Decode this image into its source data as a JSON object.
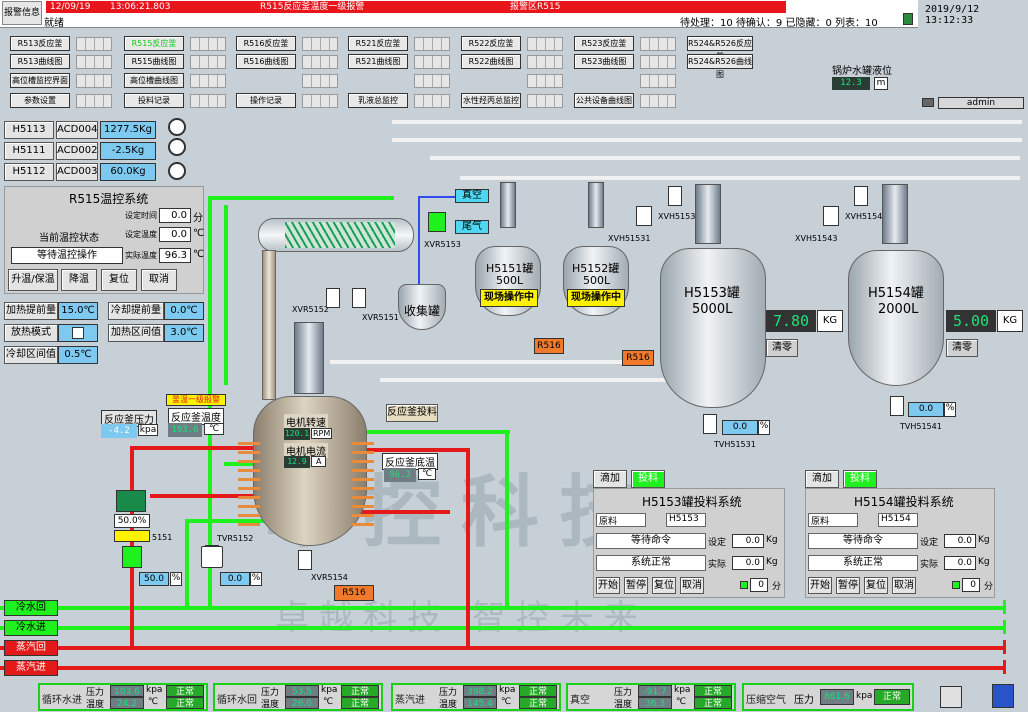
{
  "alarm": {
    "button": "报警信息",
    "date": "12/09/19",
    "time": "13:06:21.803",
    "message": "R515反应釜温度一级报警",
    "area": "报警区R515",
    "status": "就绪",
    "counts": "待处理：10  待确认：9  已隐藏：0  列表：10"
  },
  "datetime": "2019/9/12  13:12:33",
  "nav": {
    "row1": [
      "R513反应釜",
      "R515反应釜",
      "R516反应釜",
      "R521反应釜",
      "R522反应釜",
      "R523反应釜",
      "R524&R526反应釜"
    ],
    "row2": [
      "R513曲线图",
      "R515曲线图",
      "R516曲线图",
      "R521曲线图",
      "R522曲线图",
      "R523曲线图",
      "R524&R526曲线图"
    ],
    "row3": [
      "高位槽监控界面",
      "高位槽曲线图"
    ],
    "row4": [
      "参数设置",
      "投料记录",
      "操作记录",
      "乳液总监控",
      "水性羟丙总监控",
      "公共设备曲线图"
    ]
  },
  "boiler": {
    "title": "锅炉水罐液位",
    "value": "12.3",
    "unit": "m"
  },
  "user": "admin",
  "weights": [
    {
      "tank": "H5113",
      "acd": "ACD004",
      "value": "1277.5Kg"
    },
    {
      "tank": "H5111",
      "acd": "ACD002",
      "value": "-2.5Kg"
    },
    {
      "tank": "H5112",
      "acd": "ACD003",
      "value": "60.0Kg"
    }
  ],
  "temp_panel": {
    "title": "R515温控系统",
    "set_time_label": "设定时间",
    "set_time": "0.0",
    "set_time_unit": "分",
    "state_label": "当前温控状态",
    "set_temp_label": "设定温度",
    "set_temp": "0.0",
    "set_temp_unit": "℃",
    "status": "等待温控操作",
    "actual_temp_label": "实际温度",
    "actual_temp": "96.3",
    "actual_temp_unit": "℃",
    "buttons": [
      "升温/保温",
      "降温",
      "复位",
      "取消"
    ]
  },
  "params": [
    {
      "label": "加热提前量",
      "value": "15.0℃"
    },
    {
      "label": "冷却提前量",
      "value": "0.0℃"
    },
    {
      "label": "放热模式",
      "value": ""
    },
    {
      "label": "加热区间值",
      "value": "3.0℃"
    },
    {
      "label": "冷却区间值",
      "value": "0.5℃"
    }
  ],
  "reactor": {
    "alarm_tag": "釜温一级报警",
    "pressure_label": "反应釜压力",
    "pressure": "-4.2",
    "pressure_unit": "kpa",
    "temp_label": "反应釜温度",
    "temp": "103.6",
    "temp_unit": "℃",
    "motor_speed_label": "电机转速",
    "motor_speed": "120.1",
    "motor_speed_unit": "RPM",
    "motor_current_label": "电机电流",
    "motor_current": "12.9",
    "motor_current_unit": "A",
    "feed_button": "反应釜投料",
    "bottom_temp_label": "反应釜底温",
    "bottom_temp": "96.3",
    "bottom_temp_unit": "℃",
    "bottom_tag": "R516"
  },
  "valves": {
    "v1": "XVR5152",
    "v2": "XVR5151",
    "v3": "XVR5153",
    "v4": "TVR5152",
    "v5": "XVR5154",
    "v6": "XVH51532",
    "v7": "XVH51531",
    "v8": "XVH51542",
    "v9": "XVH51543",
    "v10": "TVH51531",
    "v11": "TVH51541"
  },
  "control_valve": {
    "pct": "50.0%",
    "tag": "5151",
    "out": "50.0",
    "out_unit": "%",
    "tvr": "0.0",
    "tvr_unit": "%"
  },
  "collector": "收集罐",
  "vacuum": "真空",
  "tail_gas": "尾气",
  "tanks": {
    "h5151": {
      "name": "H5151罐",
      "cap": "500L",
      "status": "现场操作中",
      "tag": "R516"
    },
    "h5152": {
      "name": "H5152罐",
      "cap": "500L",
      "status": "现场操作中",
      "tag": "R516"
    },
    "h5153": {
      "name": "H5153罐",
      "cap": "5000L",
      "weight": "7.80",
      "unit": "KG",
      "reset": "清零",
      "valve": "0.0",
      "valve_unit": "%"
    },
    "h5154": {
      "name": "H5154罐",
      "cap": "2000L",
      "weight": "5.00",
      "unit": "KG",
      "reset": "清零",
      "valve": "0.0",
      "valve_unit": "%"
    }
  },
  "feed_systems": [
    {
      "title": "H5153罐投料系统",
      "add": "滴加",
      "feed": "投料",
      "material": "原料",
      "target": "H5153",
      "cmd": "等待命令",
      "set_label": "设定",
      "set": "0.0",
      "unit": "Kg",
      "state": "系统正常",
      "act_label": "实际",
      "act": "0.0",
      "buttons": [
        "开始",
        "暂停",
        "复位",
        "取消"
      ],
      "min": "0",
      "min_unit": "分"
    },
    {
      "title": "H5154罐投料系统",
      "add": "滴加",
      "feed": "投料",
      "material": "原料",
      "target": "H5154",
      "cmd": "等待命令",
      "set_label": "设定",
      "set": "0.0",
      "unit": "Kg",
      "state": "系统正常",
      "act_label": "实际",
      "act": "0.0",
      "buttons": [
        "开始",
        "暂停",
        "复位",
        "取消"
      ],
      "min": "0",
      "min_unit": "分"
    }
  ],
  "lines": [
    "冷水回",
    "冷水进",
    "蒸汽回",
    "蒸汽进"
  ],
  "watermark": {
    "big": "卓控科技",
    "small": "卓越科技  智控未来"
  },
  "footer": [
    {
      "name": "循环水进",
      "p_label": "压力",
      "p": "103.6",
      "p_unit": "kpa",
      "t_label": "温度",
      "t": "24.2",
      "t_unit": "℃",
      "s1": "正常",
      "s2": "正常"
    },
    {
      "name": "循环水回",
      "p_label": "压力",
      "p": "53.5",
      "p_unit": "kpa",
      "t_label": "温度",
      "t": "26.0",
      "t_unit": "℃",
      "s1": "正常",
      "s2": "正常"
    },
    {
      "name": "蒸汽进",
      "p_label": "压力",
      "p": "398.2",
      "p_unit": "kpa",
      "t_label": "温度",
      "t": "145.4",
      "t_unit": "℃",
      "s1": "正常",
      "s2": "正常"
    },
    {
      "name": "真空",
      "p_label": "压力",
      "p": "-91.7",
      "p_unit": "kpa",
      "t_label": "温度",
      "t": "36.3",
      "t_unit": "℃",
      "s1": "正常",
      "s2": "正常"
    },
    {
      "name": "压缩空气",
      "p_label": "压力",
      "p": "861.6",
      "p_unit": "kpa",
      "s1": "正常"
    }
  ],
  "colors": {
    "cold": "#1ef11e",
    "steam": "#e41a1a",
    "alarm": "#e8151b",
    "value_bg": "#2a3d35",
    "value_fg": "#1be27a"
  }
}
